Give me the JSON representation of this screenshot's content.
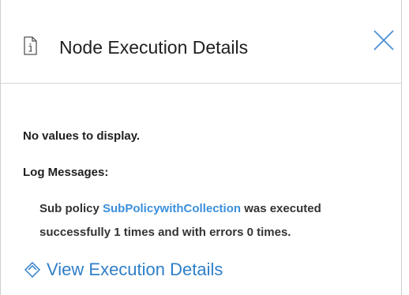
{
  "header": {
    "title": "Node Execution Details",
    "info_icon": "document-info-icon",
    "close_icon": "close-icon"
  },
  "body": {
    "no_values_text": "No values to display.",
    "log_heading": "Log Messages:",
    "log_message": {
      "prefix": "Sub policy ",
      "policy_name": "SubPolicywithCollection",
      "suffix": " was executed successfully 1 times and with errors 0 times."
    },
    "view_link": {
      "label": "View Execution Details",
      "icon": "diamond-arrow-icon"
    }
  },
  "colors": {
    "link": "#3a8fdc",
    "view_link": "#2f7fc8",
    "text": "#1f1f1f",
    "border": "#d6d6d6"
  }
}
